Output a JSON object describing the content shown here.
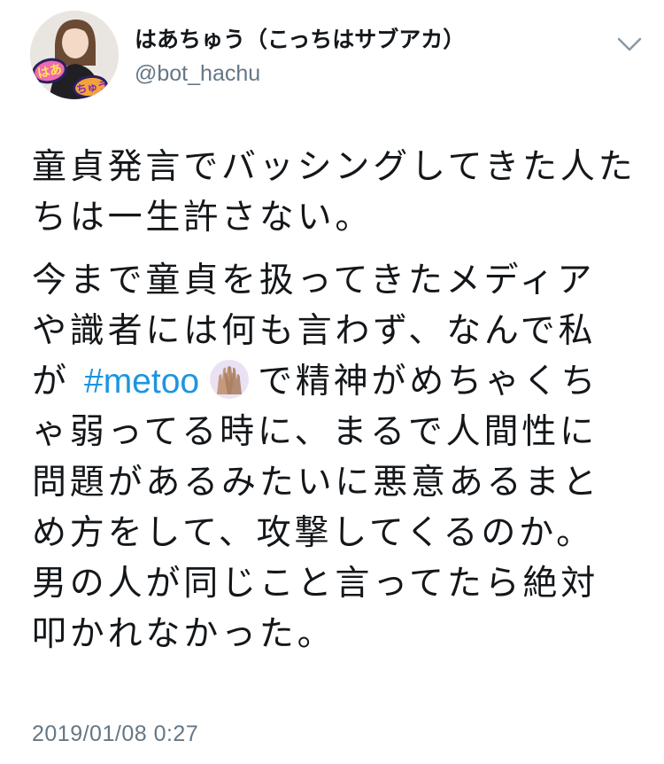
{
  "user": {
    "display_name": "はあちゅう（こっちはサブアカ）",
    "handle": "@bot_hachu",
    "avatar_sign_text_1": "はあ",
    "avatar_sign_text_2": "ちゅう"
  },
  "tweet": {
    "paragraph1": "童貞発言でバッシングしてきた人たちは一生許さない。",
    "paragraph2_lines": [
      "今まで童貞を扱ってきたメディア",
      "や識者には何も言わず、なんで私"
    ],
    "line_with_hashtag_before": "が ",
    "hashtag": "#metoo",
    "hashtag_emoji": "raised-hands-emoji",
    "line_with_hashtag_after": "で精神がめちゃくち",
    "paragraph2_rest": [
      "ゃ弱ってる時に、まるで人間性に",
      "問題があるみたいに悪意あるまと",
      "め方をして、攻撃してくるのか。",
      "男の人が同じこと言ってたら絶対",
      "叩かれなかった。"
    ],
    "timestamp": "2019/01/08 0:27"
  },
  "menu_icon": "chevron-down-icon",
  "colors": {
    "link": "#1b95e0",
    "secondary_text": "#657786",
    "primary_text": "#14171a"
  }
}
